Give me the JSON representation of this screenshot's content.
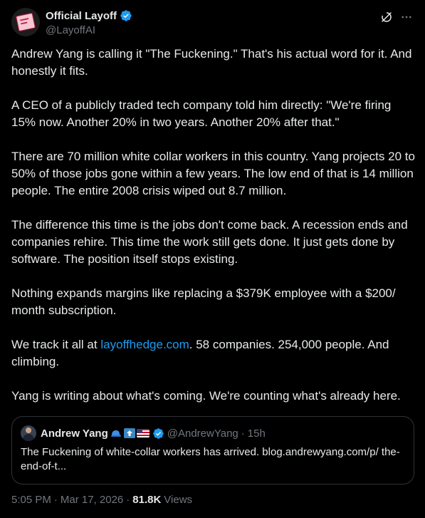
{
  "author": {
    "display_name": "Official Layoff",
    "handle": "@LayoffAI"
  },
  "body": {
    "paragraphs": [
      "Andrew Yang is calling it \"The Fuckening.\" That's his actual word for it. And honestly it fits.",
      "A CEO of a publicly traded tech company told him directly: \"We're firing 15% now. Another 20% in two years. Another 20% after that.\"",
      "There are 70 million white collar workers in this country. Yang projects 20 to 50% of those jobs gone within a few years. The low end of that is 14 million people. The entire 2008 crisis wiped out 8.7 million.",
      "The difference this time is the jobs don't come back. A recession ends and companies rehire. This time the work still gets done. It just gets done by software. The position itself stops existing.",
      "Nothing expands margins like replacing a $379K employee with a $200/ month subscription."
    ],
    "tracking": {
      "before": "We track it all at ",
      "link": "layoffhedge.com",
      "after": ". 58 companies. 254,000 people. And climbing."
    },
    "closing": "Yang is writing about what's coming. We're counting what's already here."
  },
  "quote": {
    "display_name": "Andrew Yang",
    "handle": "@AndrewYang",
    "dot": "·",
    "time": "15h",
    "text": "The Fuckening of white-collar workers has arrived.  blog.andrewyang.com/p/ the-end-of-t..."
  },
  "footer": {
    "time": "5:05 PM",
    "date": "Mar 17, 2026",
    "dot": "·",
    "views_count": "81.8K",
    "views_label": "Views"
  },
  "colors": {
    "background": "#000000",
    "text": "#e7e9ea",
    "muted": "#71767b",
    "link": "#1d9bf0",
    "border": "#2f3336",
    "verified": "#1d9bf0"
  },
  "icons": {
    "verified": "verified-badge-icon",
    "grok": "grok-icon",
    "more": "more-icon"
  }
}
